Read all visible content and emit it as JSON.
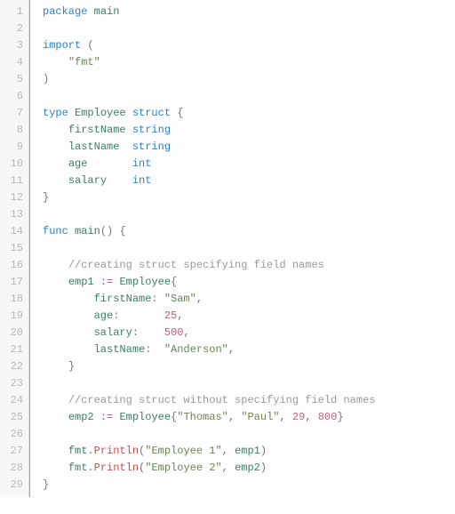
{
  "lineCount": 29,
  "code": {
    "l1": {
      "kw1": "package",
      "ident": "main"
    },
    "l3": {
      "kw1": "import",
      "paren": "("
    },
    "l4": {
      "str": "\"fmt\""
    },
    "l5": {
      "paren": ")"
    },
    "l7": {
      "kw1": "type",
      "ident": "Employee",
      "kw2": "struct",
      "brace": "{"
    },
    "l8": {
      "field": "firstName",
      "ftype": "string"
    },
    "l9": {
      "field": "lastName",
      "sp": " ",
      "ftype": "string"
    },
    "l10": {
      "field": "age",
      "sp": "      ",
      "ftype": "int"
    },
    "l11": {
      "field": "salary",
      "sp": "   ",
      "ftype": "int"
    },
    "l12": {
      "brace": "}"
    },
    "l14": {
      "kw1": "func",
      "ident": "main",
      "parens": "()",
      "brace": "{"
    },
    "l16": {
      "cmt": "//creating struct specifying field names"
    },
    "l17": {
      "ident": "emp1",
      "op": ":=",
      "typ": "Employee",
      "brace": "{"
    },
    "l18": {
      "field": "firstName",
      "colon": ":",
      "sp": " ",
      "val": "\"Sam\"",
      "comma": ","
    },
    "l19": {
      "field": "age",
      "colon": ":",
      "sp": "       ",
      "val": "25",
      "comma": ","
    },
    "l20": {
      "field": "salary",
      "colon": ":",
      "sp": "    ",
      "val": "500",
      "comma": ","
    },
    "l21": {
      "field": "lastName",
      "colon": ":",
      "sp": "  ",
      "val": "\"Anderson\"",
      "comma": ","
    },
    "l22": {
      "brace": "}"
    },
    "l24": {
      "cmt": "//creating struct without specifying field names"
    },
    "l25": {
      "ident": "emp2",
      "op": ":=",
      "typ": "Employee",
      "brace1": "{",
      "v1": "\"Thomas\"",
      "c1": ", ",
      "v2": "\"Paul\"",
      "c2": ", ",
      "v3": "29",
      "c3": ", ",
      "v4": "800",
      "brace2": "}"
    },
    "l27": {
      "pkg": "fmt",
      "dot": ".",
      "call": "Println",
      "p1": "(",
      "s1": "\"Employee 1\"",
      "c": ", ",
      "arg": "emp1",
      "p2": ")"
    },
    "l28": {
      "pkg": "fmt",
      "dot": ".",
      "call": "Println",
      "p1": "(",
      "s1": "\"Employee 2\"",
      "c": ", ",
      "arg": "emp2",
      "p2": ")"
    },
    "l29": {
      "brace": "}"
    }
  }
}
